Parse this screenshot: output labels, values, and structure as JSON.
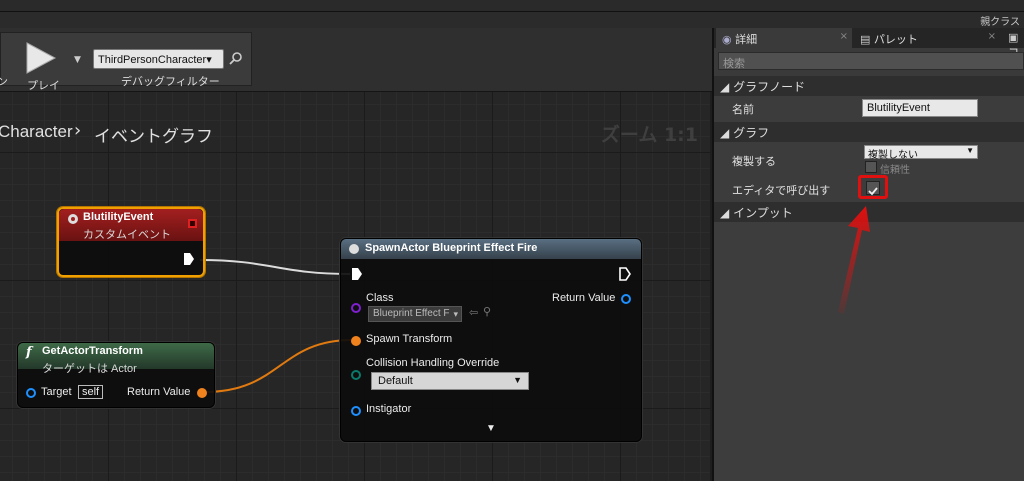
{
  "window": {
    "title": "親クラス"
  },
  "toolbar": {
    "left_label": "ン",
    "play_label": "プレイ",
    "debug_select": "ThirdPersonCharacter▾",
    "debug_label": "デバッグフィルター"
  },
  "graph": {
    "breadcrumb_root": "Character",
    "breadcrumb_current": "イベントグラフ",
    "zoom": "ズーム 1:1"
  },
  "event_node": {
    "title": "BlutilityEvent",
    "subtitle": "カスタムイベント"
  },
  "get_node": {
    "title": "GetActorTransform",
    "subtitle": "ターゲットは Actor",
    "target_label": "Target",
    "target_value": "self",
    "return_label": "Return Value"
  },
  "spawn_node": {
    "title": "SpawnActor Blueprint Effect Fire",
    "class_label": "Class",
    "class_value": "Blueprint Effect F",
    "return_label": "Return Value",
    "transform_label": "Spawn Transform",
    "collision_label": "Collision Handling Override",
    "collision_value": "Default",
    "instigator_label": "Instigator"
  },
  "panel": {
    "tabs": [
      "詳細",
      "パレット",
      "コ"
    ],
    "search_placeholder": "検索",
    "section_graph_node": "グラフノード",
    "name_label": "名前",
    "name_value": "BlutilityEvent",
    "section_graph": "グラフ",
    "replicate_label": "複製する",
    "replicate_value": "複製しない",
    "reliable_label": "信頼性",
    "call_in_editor_label": "エディタで呼び出す",
    "section_inputs": "インプット"
  },
  "colors": {
    "highlight": "#e01010",
    "event_border": "#f0a000",
    "exec": "#ffffff",
    "transform_pin": "#f0821e",
    "object_pin": "#1e90ff"
  }
}
